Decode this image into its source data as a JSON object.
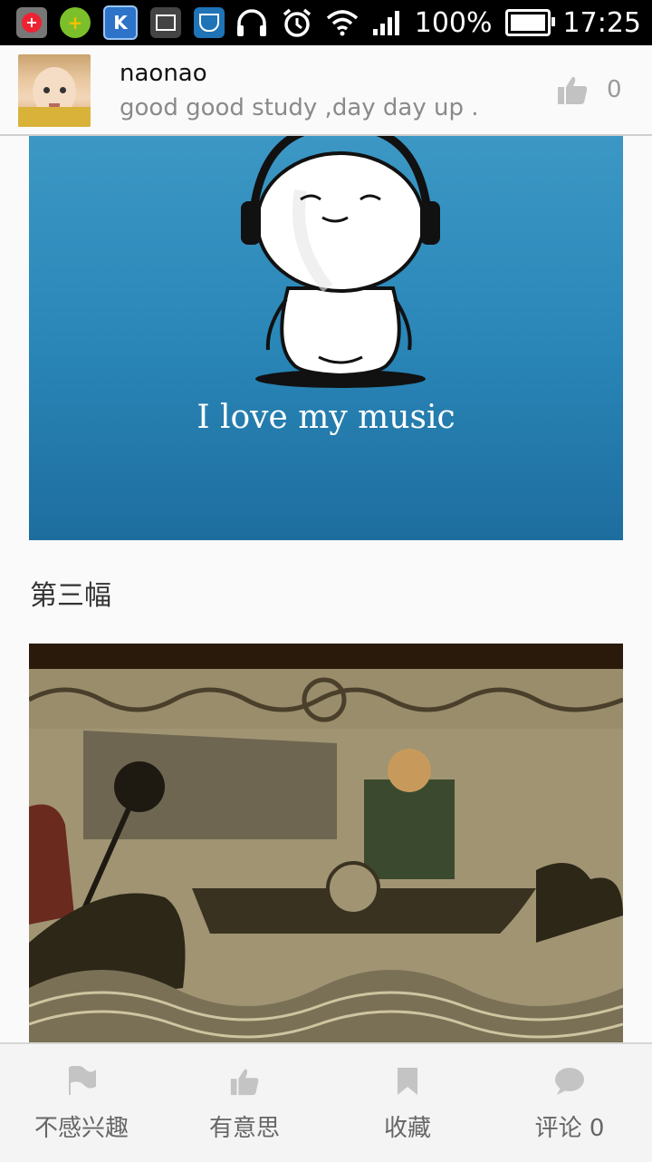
{
  "status_bar": {
    "battery": "100%",
    "time": "17:25"
  },
  "post": {
    "username": "naonao",
    "signature": "good good study ,day day up .",
    "like_count": "0"
  },
  "content": {
    "image1_caption": "I love my music",
    "section_title": "第三幅"
  },
  "bottom_bar": {
    "not_interested": "不感兴趣",
    "interesting": "有意思",
    "favorite": "收藏",
    "comment": "评论 0"
  },
  "colors": {
    "image1_blue": "#2a87b8",
    "icon_gray": "#bdbdbd"
  }
}
